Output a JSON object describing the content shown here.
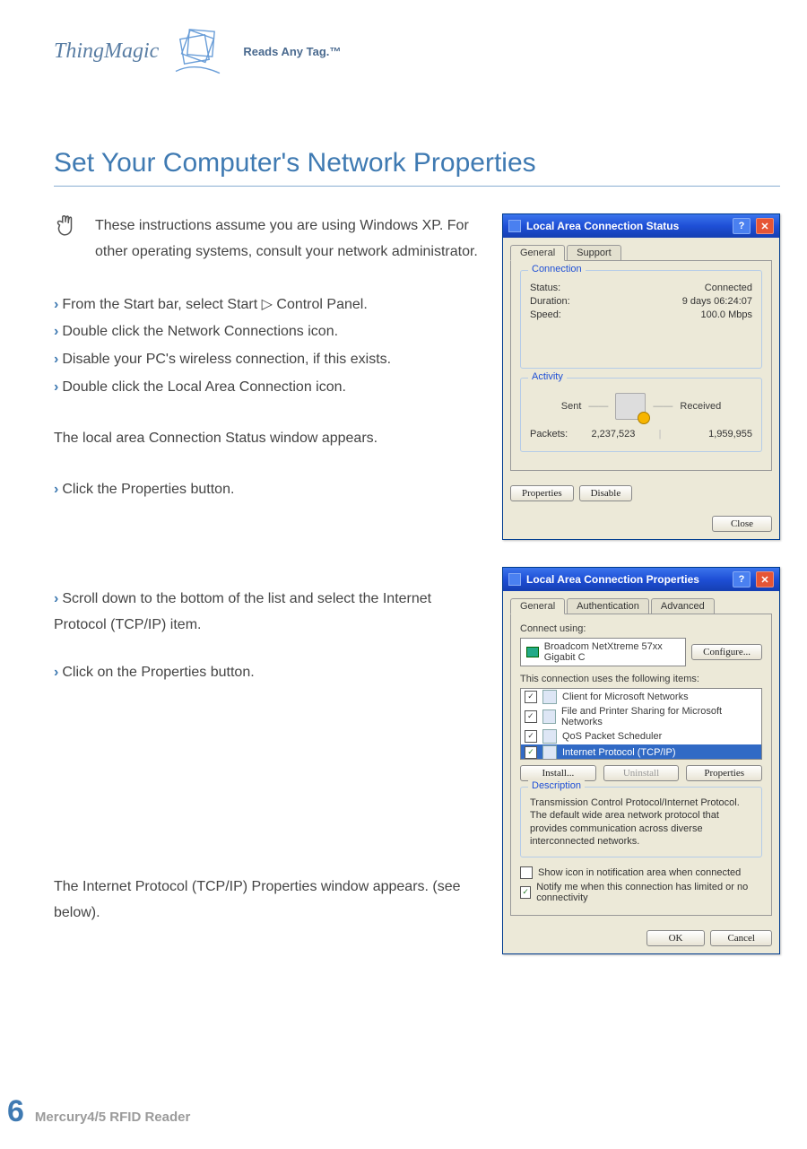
{
  "brand": {
    "name": "ThingMagic",
    "tagline": "Reads Any Tag.™"
  },
  "section_title": "Set Your Computer's Network Properties",
  "note": "These instructions assume you are using Windows XP. For other operating systems, consult your network administrator.",
  "steps": {
    "s1": "From the Start bar, select Start ▷ Control Panel.",
    "s2": "Double click the Network Connections icon.",
    "s3": "Disable your PC's wireless connection, if this exists.",
    "s4": "Double click the Local Area Connection icon."
  },
  "para1": "The local area Connection Status window appears.",
  "step5": "Click the Properties button.",
  "step6": "Scroll down to the bottom of the list and select the Internet Protocol (TCP/IP) item.",
  "step7": "Click on the Properties button.",
  "para2": "The Internet Protocol (TCP/IP) Properties window appears. (see below).",
  "footer": {
    "page": "6",
    "text": "Mercury4/5 RFID Reader"
  },
  "dlg1": {
    "title": "Local Area Connection Status",
    "tabs": [
      "General",
      "Support"
    ],
    "connection_legend": "Connection",
    "status_lbl": "Status:",
    "status_val": "Connected",
    "duration_lbl": "Duration:",
    "duration_val": "9 days 06:24:07",
    "speed_lbl": "Speed:",
    "speed_val": "100.0 Mbps",
    "activity_legend": "Activity",
    "sent_lbl": "Sent",
    "recv_lbl": "Received",
    "packets_lbl": "Packets:",
    "packets_sent": "2,237,523",
    "packets_recv": "1,959,955",
    "btn_props": "Properties",
    "btn_disable": "Disable",
    "btn_close": "Close"
  },
  "dlg2": {
    "title": "Local Area Connection Properties",
    "tabs": [
      "General",
      "Authentication",
      "Advanced"
    ],
    "connect_using": "Connect using:",
    "adapter": "Broadcom NetXtreme 57xx Gigabit C",
    "btn_configure": "Configure...",
    "items_label": "This connection uses the following items:",
    "items": [
      "Client for Microsoft Networks",
      "File and Printer Sharing for Microsoft Networks",
      "QoS Packet Scheduler",
      "Internet Protocol (TCP/IP)"
    ],
    "btn_install": "Install...",
    "btn_uninstall": "Uninstall",
    "btn_props": "Properties",
    "desc_legend": "Description",
    "desc_text": "Transmission Control Protocol/Internet Protocol. The default wide area network protocol that provides communication across diverse interconnected networks.",
    "chk1": "Show icon in notification area when connected",
    "chk2": "Notify me when this connection has limited or no connectivity",
    "btn_ok": "OK",
    "btn_cancel": "Cancel"
  }
}
